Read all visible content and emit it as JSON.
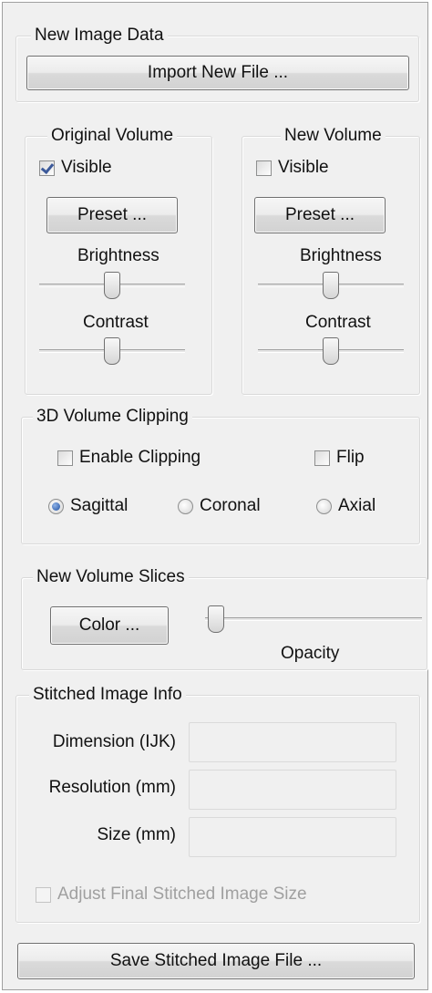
{
  "new_image_data": {
    "title": "New Image Data",
    "import_button": "Import New File ..."
  },
  "original_volume": {
    "title": "Original Volume",
    "visible_label": "Visible",
    "visible_checked": true,
    "preset_button": "Preset ...",
    "brightness_label": "Brightness",
    "brightness_value": 0.5,
    "contrast_label": "Contrast",
    "contrast_value": 0.5
  },
  "new_volume": {
    "title": "New Volume",
    "visible_label": "Visible",
    "visible_checked": false,
    "preset_button": "Preset ...",
    "brightness_label": "Brightness",
    "brightness_value": 0.5,
    "contrast_label": "Contrast",
    "contrast_value": 0.5
  },
  "clipping": {
    "title": "3D Volume Clipping",
    "enable_label": "Enable Clipping",
    "enable_checked": false,
    "flip_label": "Flip",
    "flip_checked": false,
    "sagittal_label": "Sagittal",
    "coronal_label": "Coronal",
    "axial_label": "Axial",
    "selected_plane": "Sagittal"
  },
  "slices": {
    "title": "New Volume Slices",
    "color_button": "Color ...",
    "opacity_label": "Opacity",
    "opacity_value": 0
  },
  "stitched_info": {
    "title": "Stitched Image Info",
    "dimension_label": "Dimension (IJK)",
    "dimension_value": "",
    "resolution_label": "Resolution (mm)",
    "resolution_value": "",
    "size_label": "Size (mm)",
    "size_value": "",
    "adjust_label": "Adjust Final Stitched Image Size",
    "adjust_checked": false
  },
  "save_button": "Save Stitched Image File ..."
}
